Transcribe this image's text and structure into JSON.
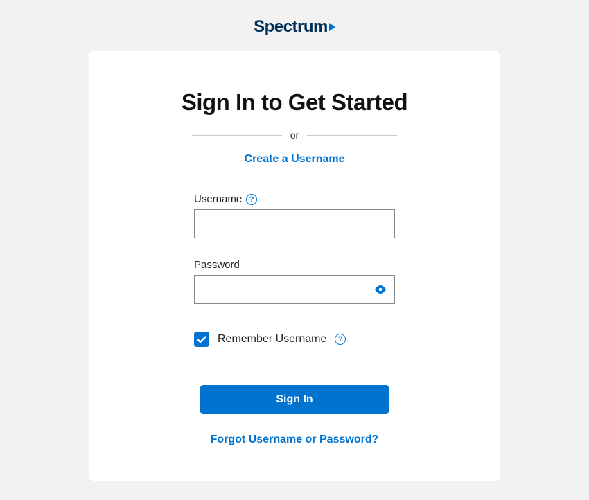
{
  "brand": {
    "name": "Spectrum"
  },
  "card": {
    "title": "Sign In to Get Started",
    "divider_text": "or",
    "create_link": "Create a Username",
    "username": {
      "label": "Username",
      "value": ""
    },
    "password": {
      "label": "Password",
      "value": ""
    },
    "remember": {
      "label": "Remember Username",
      "checked": true
    },
    "submit_label": "Sign In",
    "forgot_link": "Forgot Username or Password?"
  },
  "colors": {
    "primary": "#0073d1",
    "brand_navy": "#003057"
  }
}
